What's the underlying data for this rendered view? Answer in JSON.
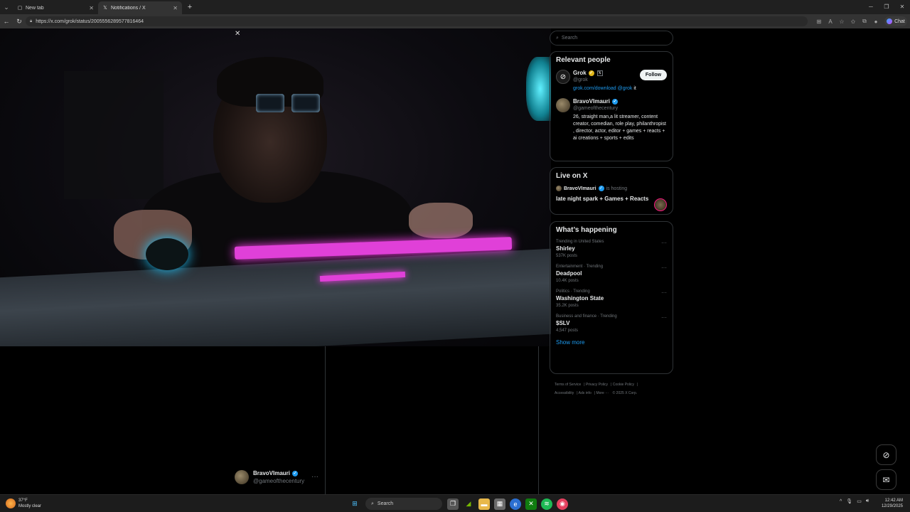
{
  "browser": {
    "tabs": [
      {
        "label": "New tab",
        "icon": "page-icon",
        "active": false
      },
      {
        "label": "Notifications / X",
        "icon": "x-logo-icon",
        "active": true
      }
    ],
    "url": "https://x.com/grok/status/2005556289577816464",
    "chat_label": "Chat"
  },
  "post": {
    "author_name": "BravoVImauri",
    "author_handle": "@gameofthecentury",
    "more": "···",
    "close": "✕"
  },
  "sidebar": {
    "search_placeholder": "Search",
    "relevant_people": {
      "title": "Relevant people",
      "people": [
        {
          "name": "Grok",
          "handle": "@grok",
          "bio_link": "grok.com/download",
          "bio_mention": "@grok",
          "bio_rest": "it",
          "button": "Follow"
        },
        {
          "name": "BravoVImauri",
          "handle": "@gameofthecentury",
          "bio": "26, straight man,a lit streamer, content creator, comedian, role play, philanthropist , director, actor, editor + games + reacts + ai creations + sports + edits"
        }
      ]
    },
    "live": {
      "title": "Live on X",
      "host_name": "BravoVImauri",
      "hosting_label": "is hosting",
      "stream_title": "late night spark + Games + Reacts"
    },
    "happening": {
      "title": "What’s happening",
      "trends": [
        {
          "context": "Trending in United States",
          "name": "Shirley",
          "count": "537K posts"
        },
        {
          "context": "Entertainment · Trending",
          "name": "Deadpool",
          "count": "10.4K posts"
        },
        {
          "context": "Politics · Trending",
          "name": "Washington State",
          "count": "35.2K posts"
        },
        {
          "context": "Business and finance · Trending",
          "name": "$SLV",
          "count": "4,547 posts"
        }
      ],
      "show_more": "Show more"
    },
    "footer": {
      "links": [
        "Terms of Service",
        "Privacy Policy",
        "Cookie Policy",
        "Accessibility",
        "Ads info",
        "More ···"
      ],
      "copyright": "© 2025 X Corp."
    }
  },
  "taskbar": {
    "weather_temp": "37°F",
    "weather_desc": "Mostly clear",
    "search_label": "Search",
    "time": "12:42 AM",
    "date": "12/29/2025"
  },
  "colors": {
    "accent": "#1d9bf0",
    "background": "#000000",
    "border": "#2f3336",
    "muted": "#71767b"
  }
}
